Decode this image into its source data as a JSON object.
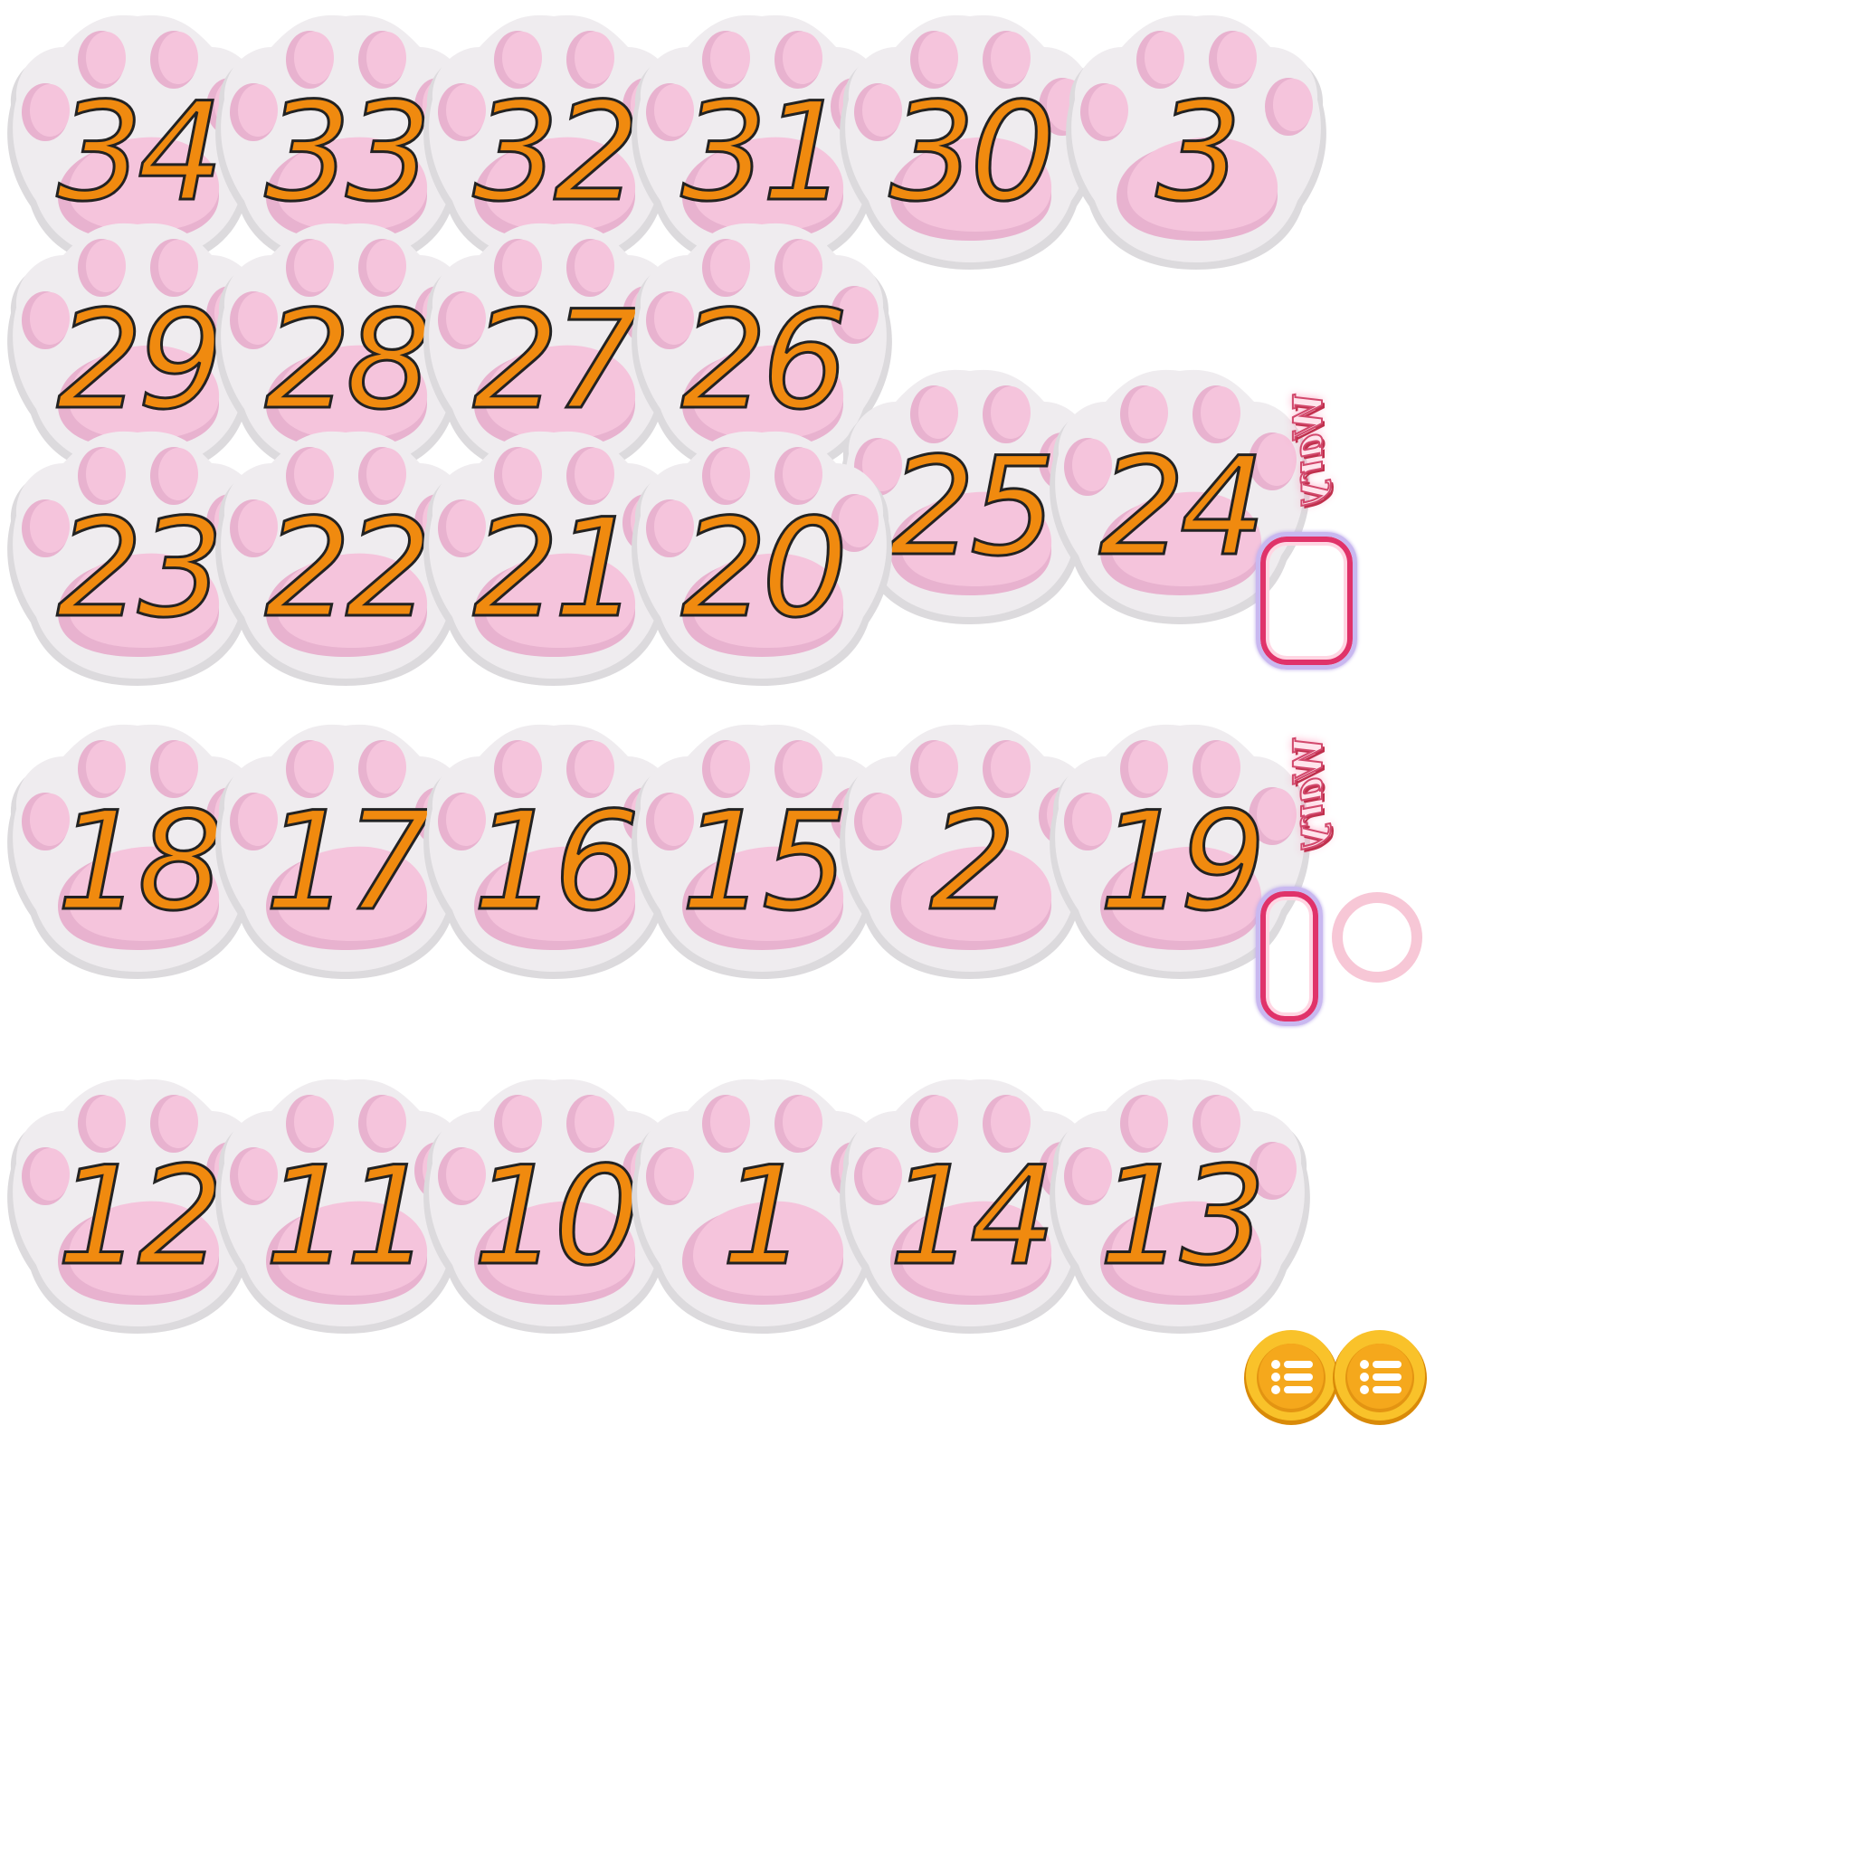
{
  "sheet": {
    "paw_tiles": [
      {
        "label": "34"
      },
      {
        "label": "33"
      },
      {
        "label": "32"
      },
      {
        "label": "31"
      },
      {
        "label": "30"
      },
      {
        "label": "3"
      },
      {
        "label": "29"
      },
      {
        "label": "28"
      },
      {
        "label": "27"
      },
      {
        "label": "26"
      },
      {
        "label": "25"
      },
      {
        "label": "24"
      },
      {
        "label": "23"
      },
      {
        "label": "22"
      },
      {
        "label": "21"
      },
      {
        "label": "20"
      },
      {
        "label": "18"
      },
      {
        "label": "17"
      },
      {
        "label": "16"
      },
      {
        "label": "15"
      },
      {
        "label": "2"
      },
      {
        "label": "19"
      },
      {
        "label": "12"
      },
      {
        "label": "11"
      },
      {
        "label": "10"
      },
      {
        "label": "1"
      },
      {
        "label": "14"
      },
      {
        "label": "13"
      }
    ],
    "stickers": [
      {
        "label": "Wary"
      },
      {
        "label": "Wary"
      }
    ],
    "icons": {
      "menu_coin": "menu-list-icon"
    },
    "colors": {
      "paw_body": "#efecef",
      "paw_pad": "#f5bfd9",
      "number_fill": "#f08a0f",
      "number_outline": "#222222",
      "coin": "#f5b41a",
      "frame_accent": "#e0336a"
    }
  }
}
